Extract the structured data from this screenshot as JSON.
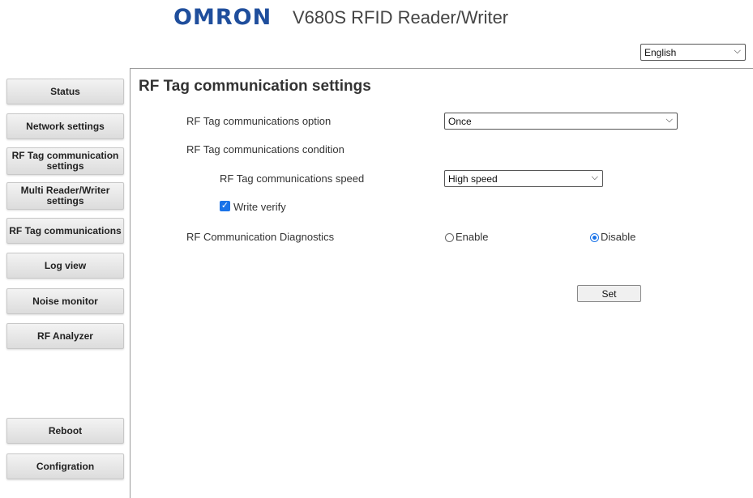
{
  "header": {
    "logo": "OMRON",
    "title": "V680S RFID Reader/Writer",
    "language": "English"
  },
  "sidebar": {
    "items": [
      {
        "label": "Status"
      },
      {
        "label": "Network settings"
      },
      {
        "label": "RF Tag communication settings"
      },
      {
        "label": "Multi Reader/Writer settings"
      },
      {
        "label": "RF Tag communications"
      },
      {
        "label": "Log view"
      },
      {
        "label": "Noise monitor"
      },
      {
        "label": "RF Analyzer"
      }
    ],
    "bottom_items": [
      {
        "label": "Reboot"
      },
      {
        "label": "Configration"
      }
    ]
  },
  "main": {
    "title": "RF Tag communication settings",
    "comm_option_label": "RF Tag communications option",
    "comm_option_value": "Once",
    "comm_condition_label": "RF Tag communications condition",
    "comm_speed_label": "RF Tag communications speed",
    "comm_speed_value": "High speed",
    "write_verify_label": "Write verify",
    "write_verify_checked": true,
    "diagnostics_label": "RF Communication Diagnostics",
    "diagnostics_enable": "Enable",
    "diagnostics_disable": "Disable",
    "diagnostics_selected": "Disable",
    "set_label": "Set"
  },
  "colors": {
    "brand": "#1f4e9c",
    "accent": "#1a73e8"
  }
}
